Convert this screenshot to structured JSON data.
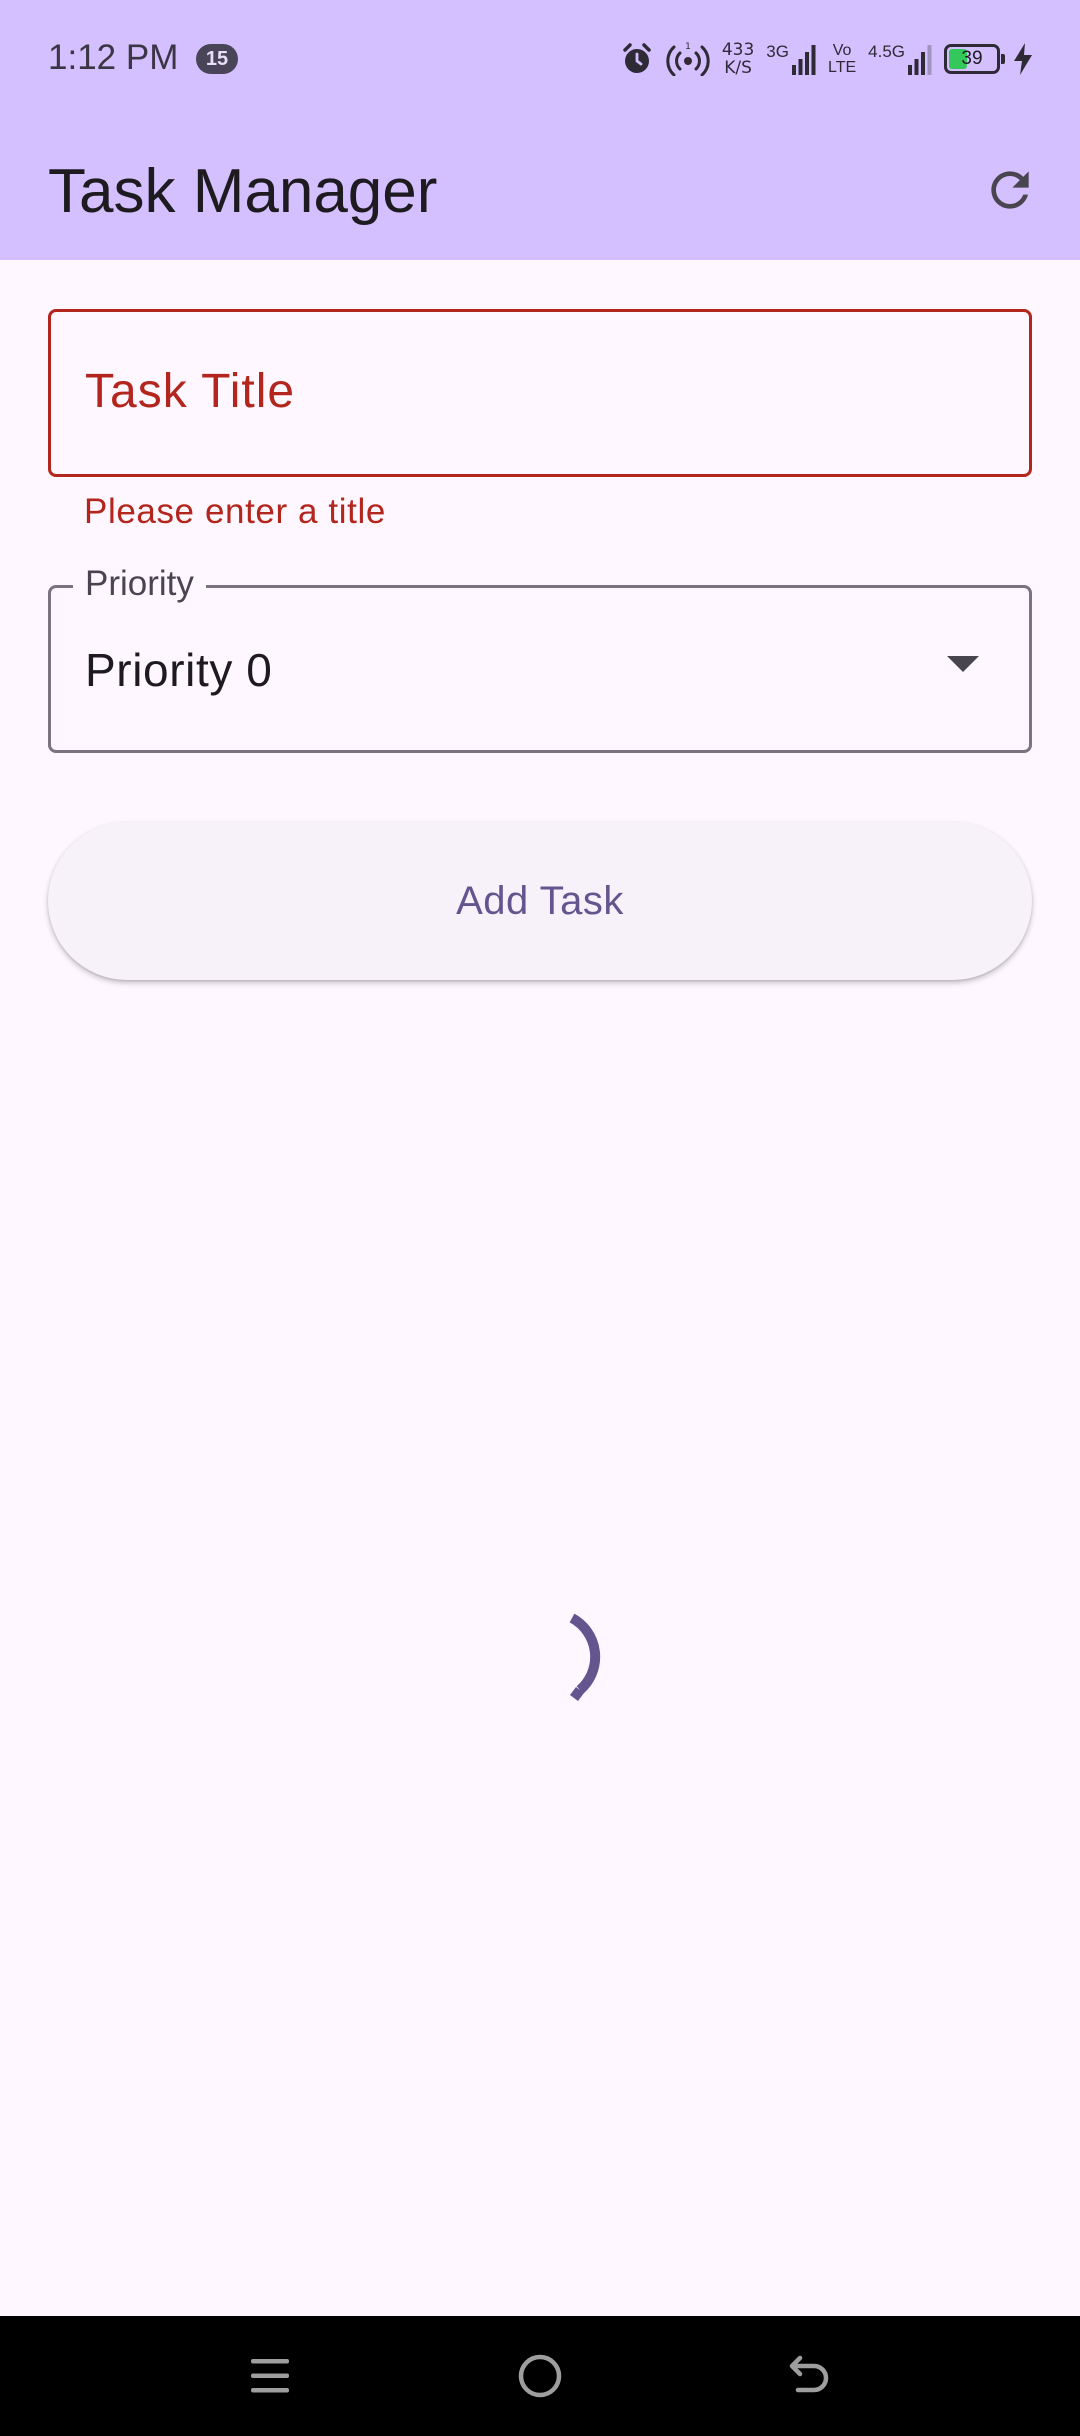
{
  "status_bar": {
    "time": "1:12 PM",
    "notification_count": "15",
    "net_speed_value": "433",
    "net_speed_unit": "K/S",
    "network_3g": "3G",
    "volte_top": "Vo",
    "volte_bottom": "LTE",
    "network_45g": "4.5G",
    "battery_level": "39",
    "battery_fraction": 0.39,
    "icons": [
      "alarm-icon",
      "hotspot-icon",
      "signal-icon",
      "signal-icon",
      "battery-icon",
      "charging-icon"
    ]
  },
  "app_bar": {
    "title": "Task Manager",
    "action_icon": "refresh-icon"
  },
  "form": {
    "title_placeholder": "Task Title",
    "title_value": "",
    "title_error": "Please enter a title",
    "priority_label": "Priority",
    "priority_value": "Priority 0",
    "add_button_label": "Add Task"
  },
  "loading": {
    "indicator": "circular-progress"
  },
  "nav_bar": {
    "buttons": [
      "menu-icon",
      "home-icon",
      "back-icon"
    ]
  },
  "colors": {
    "app_bar_bg": "#D4BFFF",
    "page_bg": "#FEF7FF",
    "error": "#B3261E",
    "primary": "#65558F",
    "outline": "#79747E"
  }
}
